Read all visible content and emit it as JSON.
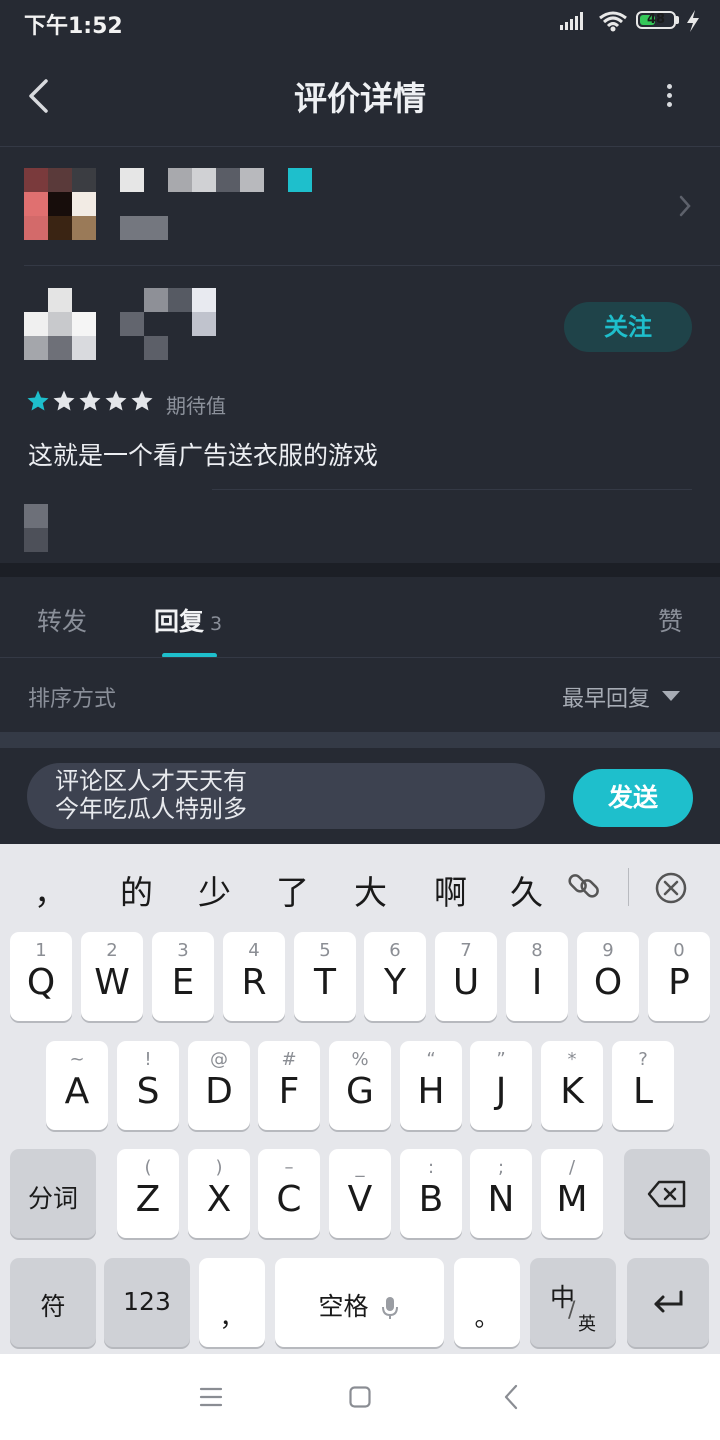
{
  "status_bar": {
    "time": "下午1:52",
    "battery": "48"
  },
  "header": {
    "title": "评价详情"
  },
  "review": {
    "rating_label": "期待值",
    "stars_filled": 1,
    "stars_total": 5,
    "text": "这就是一个看广告送衣服的游戏",
    "follow_label": "关注"
  },
  "tabs": {
    "forward": "转发",
    "reply": "回复",
    "reply_count": "3",
    "like": "赞"
  },
  "sort": {
    "label": "排序方式",
    "value": "最早回复"
  },
  "comment": {
    "line1": "评论区人才天天有",
    "line2": "今年吃瓜人特别多",
    "send_label": "发送"
  },
  "keyboard": {
    "candidates": [
      "，",
      "的",
      "少",
      "了",
      "大",
      "啊",
      "久"
    ],
    "row1": [
      {
        "hint": "1",
        "key": "Q"
      },
      {
        "hint": "2",
        "key": "W"
      },
      {
        "hint": "3",
        "key": "E"
      },
      {
        "hint": "4",
        "key": "R"
      },
      {
        "hint": "5",
        "key": "T"
      },
      {
        "hint": "6",
        "key": "Y"
      },
      {
        "hint": "7",
        "key": "U"
      },
      {
        "hint": "8",
        "key": "I"
      },
      {
        "hint": "9",
        "key": "O"
      },
      {
        "hint": "0",
        "key": "P"
      }
    ],
    "row2": [
      {
        "hint": "~",
        "key": "A"
      },
      {
        "hint": "!",
        "key": "S"
      },
      {
        "hint": "@",
        "key": "D"
      },
      {
        "hint": "#",
        "key": "F"
      },
      {
        "hint": "%",
        "key": "G"
      },
      {
        "hint": "“",
        "key": "H"
      },
      {
        "hint": "”",
        "key": "J"
      },
      {
        "hint": "*",
        "key": "K"
      },
      {
        "hint": "?",
        "key": "L"
      }
    ],
    "row3": [
      {
        "hint": "(",
        "key": "Z"
      },
      {
        "hint": ")",
        "key": "X"
      },
      {
        "hint": "–",
        "key": "C"
      },
      {
        "hint": "_",
        "key": "V"
      },
      {
        "hint": ":",
        "key": "B"
      },
      {
        "hint": ";",
        "key": "N"
      },
      {
        "hint": "/",
        "key": "M"
      }
    ],
    "segment_label": "分词",
    "symbol_label": "符",
    "number_label": "123",
    "comma": "，",
    "space_label": "空格",
    "period": "。",
    "lang_main": "中",
    "lang_sub": "英"
  },
  "colors": {
    "accent": "#1ebfcc",
    "background": "#262a33",
    "follow_bg": "#1f4349"
  }
}
